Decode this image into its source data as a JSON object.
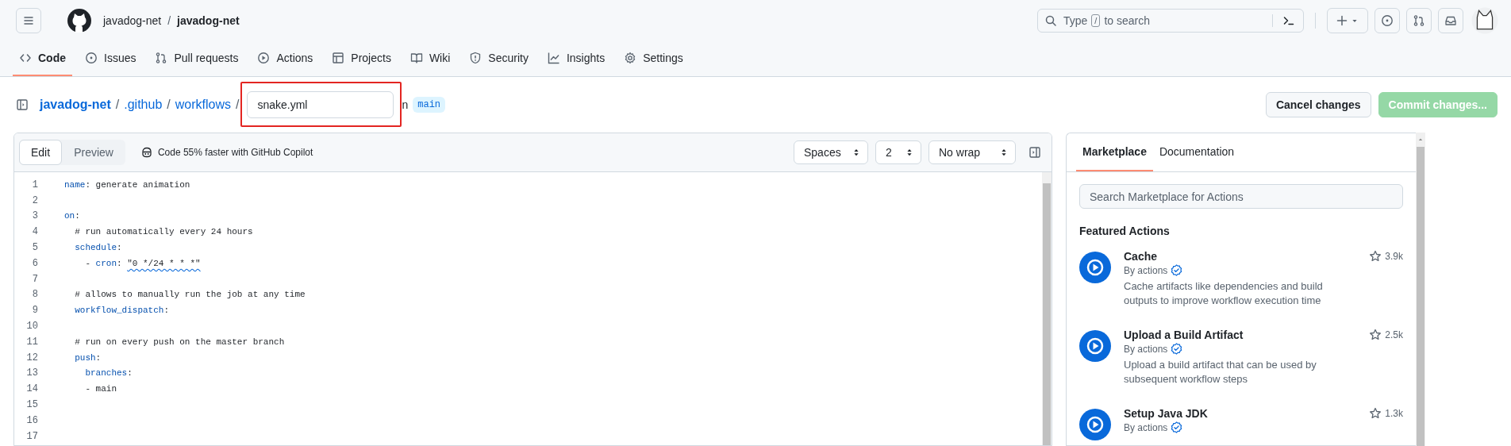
{
  "header": {
    "owner": "javadog-net",
    "separator": "/",
    "repo": "javadog-net",
    "search": {
      "before": "Type",
      "key": "/",
      "after": "to search"
    }
  },
  "repo_tabs": [
    {
      "label": "Code",
      "selected": true
    },
    {
      "label": "Issues",
      "selected": false
    },
    {
      "label": "Pull requests",
      "selected": false
    },
    {
      "label": "Actions",
      "selected": false
    },
    {
      "label": "Projects",
      "selected": false
    },
    {
      "label": "Wiki",
      "selected": false
    },
    {
      "label": "Security",
      "selected": false
    },
    {
      "label": "Insights",
      "selected": false
    },
    {
      "label": "Settings",
      "selected": false
    }
  ],
  "breadcrumb": {
    "parts": [
      "javadog-net",
      ".github",
      "workflows"
    ],
    "separator": "/",
    "filename": "snake.yml",
    "in_label": "n",
    "branch": "main"
  },
  "actions": {
    "cancel": "Cancel changes",
    "commit": {
      "label": "Commit changes...",
      "disabled": true
    }
  },
  "editor": {
    "modes": [
      {
        "label": "Edit",
        "selected": true
      },
      {
        "label": "Preview",
        "selected": false
      }
    ],
    "copilot": "Code 55% faster with GitHub Copilot",
    "selects": [
      "Spaces",
      "2",
      "No wrap"
    ],
    "lines": [
      {
        "number": "1",
        "segments": [
          {
            "kind": "key",
            "text": "name"
          },
          {
            "kind": "plain",
            "text": ": generate animation"
          }
        ]
      },
      {
        "number": "2"
      },
      {
        "number": "3",
        "segments": [
          {
            "kind": "key",
            "text": "on"
          },
          {
            "kind": "plain",
            "text": ":"
          }
        ]
      },
      {
        "number": "4",
        "segments": [
          {
            "kind": "comment",
            "text": "  # run automatically every 24 hours"
          }
        ]
      },
      {
        "number": "5",
        "segments": [
          {
            "kind": "key",
            "text": "  schedule"
          },
          {
            "kind": "plain",
            "text": ":"
          }
        ]
      },
      {
        "number": "6",
        "segments": [
          {
            "kind": "plain",
            "text": "    - "
          },
          {
            "kind": "key",
            "text": "cron"
          },
          {
            "kind": "plain",
            "text": ": "
          },
          {
            "kind": "string",
            "text": "\"0 */24 * * *\"",
            "warning": true
          }
        ]
      },
      {
        "number": "7"
      },
      {
        "number": "8",
        "segments": [
          {
            "kind": "comment",
            "text": "  # allows to manually run the job at any time"
          }
        ]
      },
      {
        "number": "9",
        "segments": [
          {
            "kind": "key",
            "text": "  workflow_dispatch"
          },
          {
            "kind": "plain",
            "text": ":"
          }
        ]
      },
      {
        "number": "10"
      },
      {
        "number": "11",
        "segments": [
          {
            "kind": "comment",
            "text": "  # run on every push on the master branch"
          }
        ]
      },
      {
        "number": "12",
        "segments": [
          {
            "kind": "key",
            "text": "  push"
          },
          {
            "kind": "plain",
            "text": ":"
          }
        ]
      },
      {
        "number": "13",
        "segments": [
          {
            "kind": "key",
            "text": "    branches"
          },
          {
            "kind": "plain",
            "text": ":"
          }
        ]
      },
      {
        "number": "14",
        "segments": [
          {
            "kind": "plain",
            "text": "    - main"
          }
        ]
      },
      {
        "number": "15"
      },
      {
        "number": "16"
      },
      {
        "number": "17"
      }
    ]
  },
  "sidebar": {
    "tabs": [
      {
        "label": "Marketplace",
        "selected": true
      },
      {
        "label": "Documentation",
        "selected": false
      }
    ],
    "search": {
      "placeholder": "Search Marketplace for Actions"
    },
    "heading": "Featured Actions",
    "items": [
      {
        "title": "Cache",
        "by": "By actions",
        "verified": true,
        "stars": "3.9k",
        "description": "Cache artifacts like dependencies and build outputs to improve workflow execution time"
      },
      {
        "title": "Upload a Build Artifact",
        "by": "By actions",
        "verified": true,
        "stars": "2.5k",
        "description": "Upload a build artifact that can be used by subsequent workflow steps"
      },
      {
        "title": "Setup Java JDK",
        "by": "By actions",
        "verified": true,
        "stars": "1.3k"
      }
    ]
  }
}
